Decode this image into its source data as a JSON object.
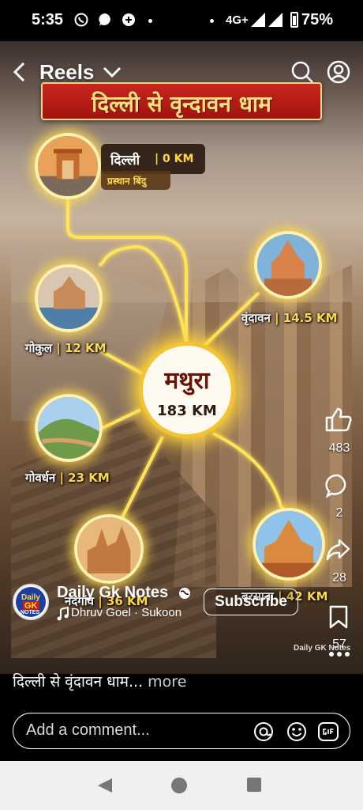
{
  "status_bar": {
    "time": "5:35",
    "network": "4G+",
    "battery": "75%",
    "icons": [
      "whatsapp-icon",
      "messenger-icon",
      "app-icon",
      "dot-icon",
      "signal-icon",
      "battery-icon"
    ]
  },
  "header": {
    "title": "Reels",
    "icons": [
      "back-icon",
      "chevron-down-icon",
      "search-icon",
      "profile-icon"
    ]
  },
  "reel": {
    "banner": "दिल्ली से वृन्दावन धाम",
    "start": {
      "name": "दिल्ली",
      "km": "| 0 KM",
      "sub": "प्रस्थान बिंदु"
    },
    "center": {
      "name": "मथुरा",
      "km": "183 KM"
    },
    "places": [
      {
        "name": "वृंदावन",
        "km": "| 14.5 KM"
      },
      {
        "name": "गोकुल",
        "km": "| 12 KM"
      },
      {
        "name": "गोवर्धन",
        "km": "| 23 KM"
      },
      {
        "name": "नंदगांव",
        "km": "| 36 KM"
      },
      {
        "name": "बरसाना",
        "km": "| 42 KM"
      }
    ],
    "watermark": "Daily GK Notes",
    "colors": {
      "banner": "#b51c14",
      "banner_text": "#ffe27a",
      "km": "#ffd84a",
      "glow": "#ffd63c"
    }
  },
  "actions": {
    "like_count": "483",
    "comment_count": "2",
    "share_count": "28",
    "save_count": "57"
  },
  "author": {
    "avatar_line1": "Daily",
    "avatar_line2": "GK",
    "avatar_line3": "NOTES",
    "name": "Daily Gk Notes",
    "audio": "Dhruv Goel · Sukoon",
    "subscribe": "Subscribe"
  },
  "caption": {
    "text": "दिल्ली से वृंदावन धाम...",
    "more": "more"
  },
  "comment": {
    "placeholder": "Add a comment..."
  },
  "nav": {
    "icons": [
      "back-nav-icon",
      "home-nav-icon",
      "recents-nav-icon"
    ]
  }
}
